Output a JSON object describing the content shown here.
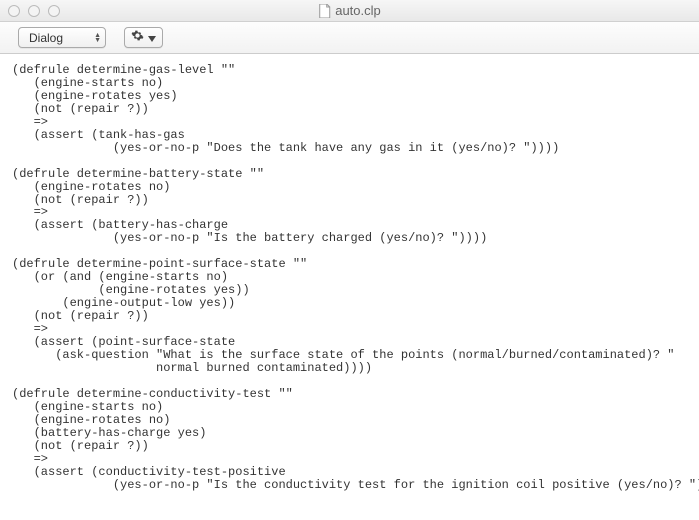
{
  "window": {
    "title": "auto.clp"
  },
  "toolbar": {
    "dropdown_label": "Dialog",
    "gear_label": ""
  },
  "editor": {
    "code": "(defrule determine-gas-level \"\"\n   (engine-starts no)\n   (engine-rotates yes)\n   (not (repair ?))\n   =>\n   (assert (tank-has-gas\n              (yes-or-no-p \"Does the tank have any gas in it (yes/no)? \"))))\n\n(defrule determine-battery-state \"\"\n   (engine-rotates no)\n   (not (repair ?))\n   =>\n   (assert (battery-has-charge\n              (yes-or-no-p \"Is the battery charged (yes/no)? \"))))\n\n(defrule determine-point-surface-state \"\"\n   (or (and (engine-starts no)\n            (engine-rotates yes))\n       (engine-output-low yes))\n   (not (repair ?))\n   =>\n   (assert (point-surface-state\n      (ask-question \"What is the surface state of the points (normal/burned/contaminated)? \"\n                    normal burned contaminated))))\n\n(defrule determine-conductivity-test \"\"\n   (engine-starts no)\n   (engine-rotates no)\n   (battery-has-charge yes)\n   (not (repair ?))\n   =>\n   (assert (conductivity-test-positive\n              (yes-or-no-p \"Is the conductivity test for the ignition coil positive (yes/no)? \"))))"
  }
}
